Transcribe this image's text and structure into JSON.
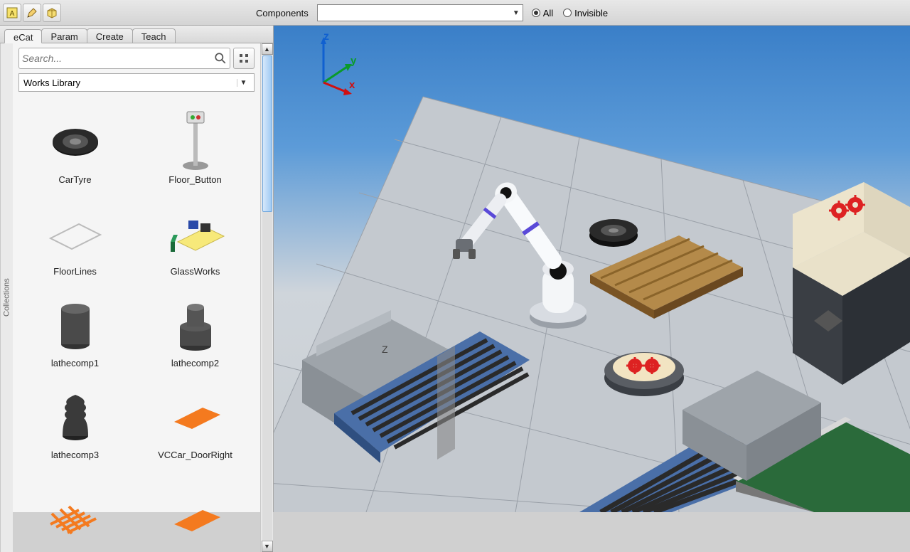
{
  "toolbar": {
    "components_label": "Components",
    "radio_all": "All",
    "radio_invisible": "Invisible"
  },
  "tabs": {
    "ecat": "eCat",
    "param": "Param",
    "create": "Create",
    "teach": "Teach"
  },
  "sidebar": {
    "collections_label": "Collections",
    "search_placeholder": "Search...",
    "library": "Works Library"
  },
  "catalog": [
    {
      "name": "CarTyre"
    },
    {
      "name": "Floor_Button"
    },
    {
      "name": "FloorLines"
    },
    {
      "name": "GlassWorks"
    },
    {
      "name": "lathecomp1"
    },
    {
      "name": "lathecomp2"
    },
    {
      "name": "lathecomp3"
    },
    {
      "name": "VCCar_DoorRight"
    }
  ],
  "axis": {
    "x": "x",
    "y": "y",
    "z": "z"
  },
  "scene_marker": "Z"
}
